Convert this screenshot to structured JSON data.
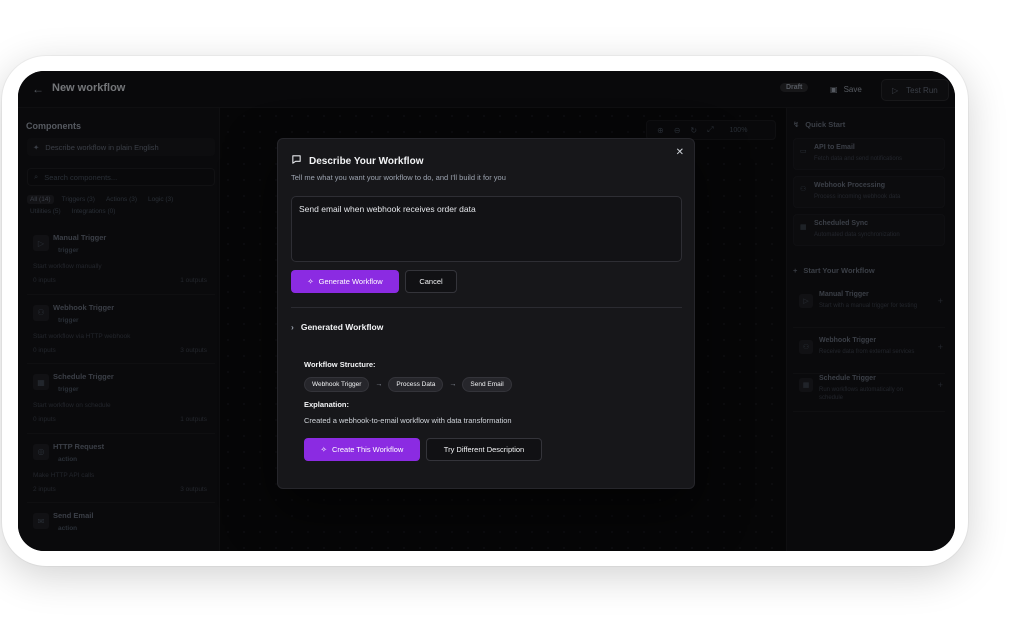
{
  "topbar": {
    "back_icon": "arrow-left-icon",
    "title": "New workflow",
    "badge": "Draft",
    "save_label": "Save",
    "test_run_label": "Test Run"
  },
  "left_panel": {
    "title": "Components",
    "describe_label": "Describe workflow in plain English",
    "search_placeholder": "Search components...",
    "filters": [
      "All (14)",
      "Triggers (3)",
      "Actions (3)",
      "Logic (3)",
      "Utilities (5)",
      "Integrations (0)"
    ],
    "components": [
      {
        "name": "Manual Trigger",
        "type": "trigger",
        "desc": "Start workflow manually",
        "inputs": "0 inputs",
        "outputs": "1 outputs"
      },
      {
        "name": "Webhook Trigger",
        "type": "trigger",
        "desc": "Start workflow via HTTP webhook",
        "inputs": "0 inputs",
        "outputs": "3 outputs"
      },
      {
        "name": "Schedule Trigger",
        "type": "trigger",
        "desc": "Start workflow on schedule",
        "inputs": "0 inputs",
        "outputs": "1 outputs"
      },
      {
        "name": "HTTP Request",
        "type": "action",
        "desc": "Make HTTP API calls",
        "inputs": "2 inputs",
        "outputs": "3 outputs"
      },
      {
        "name": "Send Email",
        "type": "action",
        "desc": "",
        "inputs": "",
        "outputs": ""
      }
    ]
  },
  "canvas": {
    "zoom_level": "100%"
  },
  "right_panel": {
    "quick_start_title": "Quick Start",
    "quick_start": [
      {
        "title": "API to Email",
        "desc": "Fetch data and send notifications"
      },
      {
        "title": "Webhook Processing",
        "desc": "Process incoming webhook data"
      },
      {
        "title": "Scheduled Sync",
        "desc": "Automated data synchronization"
      }
    ],
    "start_title": "Start Your Workflow",
    "start_items": [
      {
        "title": "Manual Trigger",
        "desc": "Start with a manual trigger for testing"
      },
      {
        "title": "Webhook Trigger",
        "desc": "Receive data from external services"
      },
      {
        "title": "Schedule Trigger",
        "desc": "Run workflows automatically on schedule"
      }
    ]
  },
  "modal": {
    "title": "Describe Your Workflow",
    "subtitle": "Tell me what you want your workflow to do, and I'll build it for you",
    "input_value": "Send email when webhook receives order data",
    "generate_label": "Generate Workflow",
    "cancel_label": "Cancel",
    "generated_title": "Generated Workflow",
    "structure_label": "Workflow Structure:",
    "steps": [
      "Webhook Trigger",
      "Process Data",
      "Send Email"
    ],
    "explanation_label": "Explanation:",
    "explanation_text": "Created a webhook-to-email workflow with data transformation",
    "create_label": "Create This Workflow",
    "retry_label": "Try Different Description",
    "accent_color": "#8b2be2"
  }
}
